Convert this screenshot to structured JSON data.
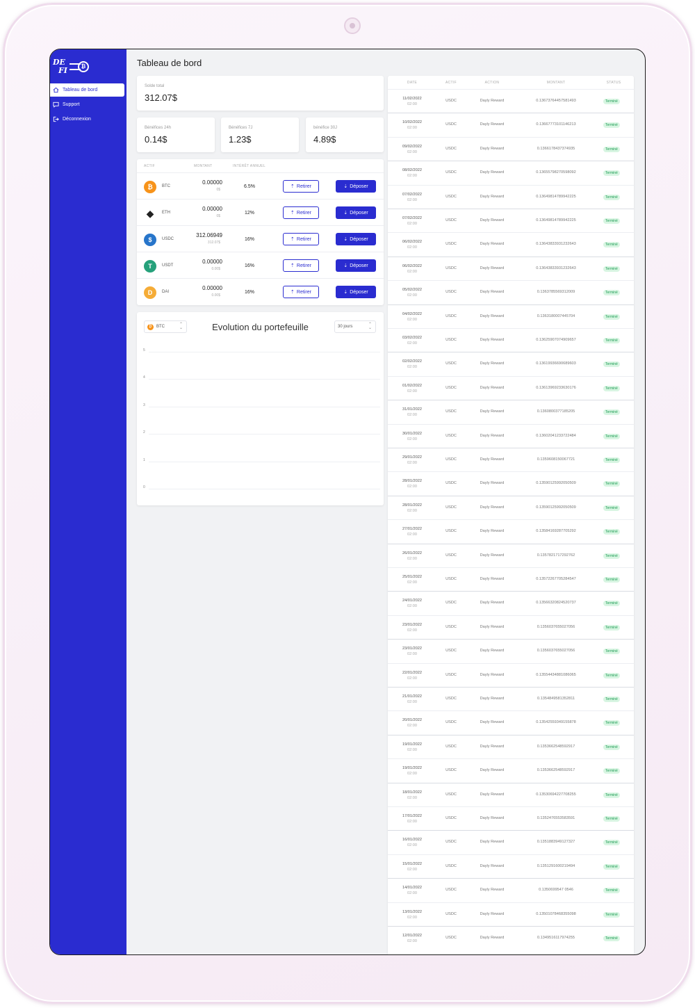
{
  "app": {
    "logo_line1": "DE",
    "logo_line2": "FI",
    "logo_coin": "₿"
  },
  "page": {
    "title": "Tableau de bord"
  },
  "nav": [
    {
      "label": "Tableau de bord",
      "icon": "home-icon",
      "active": true
    },
    {
      "label": "Support",
      "icon": "chat-icon",
      "active": false
    },
    {
      "label": "Déconnexion",
      "icon": "logout-icon",
      "active": false
    }
  ],
  "balance": {
    "label": "Solde total",
    "value": "312.07$"
  },
  "profits": [
    {
      "label": "Bénéfices 24h",
      "value": "0.14$"
    },
    {
      "label": "Bénéfices 7J",
      "value": "1.23$"
    },
    {
      "label": "bénéfice 30J",
      "value": "4.89$"
    }
  ],
  "assets_table": {
    "headers": {
      "asset": "ACTIF",
      "amount": "MONTANT",
      "interest": "INTÉRÊT ANNUEL"
    },
    "withdraw_label": "Retirer",
    "deposit_label": "Déposer",
    "rows": [
      {
        "name": "BTC",
        "amount": "0.00000",
        "sub": "0$",
        "interest": "6.5%",
        "icon": "bitcoin-icon",
        "color": "#f7931a",
        "glyph": "₿"
      },
      {
        "name": "ETH",
        "amount": "0.00000",
        "sub": "0$",
        "interest": "12%",
        "icon": "ethereum-icon",
        "color": "#222222",
        "glyph": "◆"
      },
      {
        "name": "USDC",
        "amount": "312.06949",
        "sub": "312.07$",
        "interest": "16%",
        "icon": "usdc-icon",
        "color": "#2775ca",
        "glyph": "$"
      },
      {
        "name": "USDT",
        "amount": "0.00000",
        "sub": "0.00$",
        "interest": "16%",
        "icon": "tether-icon",
        "color": "#26a17b",
        "glyph": "T"
      },
      {
        "name": "DAI",
        "amount": "0.00000",
        "sub": "0.00$",
        "interest": "16%",
        "icon": "dai-icon",
        "color": "#f5ac37",
        "glyph": "D"
      }
    ]
  },
  "portfolio_chart": {
    "title": "Evolution du portefeuille",
    "asset_select": "BTC",
    "period_select": "30 jours",
    "y_ticks": [
      "5",
      "4",
      "3",
      "2",
      "1",
      "0"
    ]
  },
  "chart_data": {
    "type": "line",
    "title": "Evolution du portefeuille",
    "series": [],
    "ylim": [
      0,
      5
    ],
    "grid": true
  },
  "transactions": {
    "headers": {
      "date": "DATE",
      "asset": "ACTIF",
      "action": "ACTION",
      "amount": "MONTANT",
      "status": "STATUS"
    },
    "rows": [
      {
        "date": "11/02/2022",
        "time": "02:00",
        "asset": "USDC",
        "action": "Dayly Reward",
        "amount": "0.13673764457581493",
        "status": "Terminé"
      },
      {
        "date": "10/02/2022",
        "time": "02:00",
        "asset": "USDC",
        "action": "Dayly Reward",
        "amount": "0.13667773101146213",
        "status": "Terminé"
      },
      {
        "date": "09/02/2022",
        "time": "02:00",
        "asset": "USDC",
        "action": "Dayly Reward",
        "amount": "0.1366178437374935",
        "status": "Terminé"
      },
      {
        "date": "08/02/2022",
        "time": "02:00",
        "asset": "USDC",
        "action": "Dayly Reward",
        "amount": "0.13655798270598092",
        "status": "Terminé"
      },
      {
        "date": "07/02/2022",
        "time": "02:00",
        "asset": "USDC",
        "action": "Dayly Reward",
        "amount": "0.13649814789942225",
        "status": "Terminé"
      },
      {
        "date": "07/02/2022",
        "time": "02:00",
        "asset": "USDC",
        "action": "Dayly Reward",
        "amount": "0.13649814789942225",
        "status": "Terminé"
      },
      {
        "date": "06/02/2022",
        "time": "02:00",
        "asset": "USDC",
        "action": "Dayly Reward",
        "amount": "0.13643833931232643",
        "status": "Terminé"
      },
      {
        "date": "06/02/2022",
        "time": "02:00",
        "asset": "USDC",
        "action": "Dayly Reward",
        "amount": "0.13643833931232643",
        "status": "Terminé"
      },
      {
        "date": "05/02/2022",
        "time": "02:00",
        "asset": "USDC",
        "action": "Dayly Reward",
        "amount": "0.1363785569312009",
        "status": "Terminé"
      },
      {
        "date": "04/02/2022",
        "time": "02:00",
        "asset": "USDC",
        "action": "Dayly Reward",
        "amount": "0.1363180007445704",
        "status": "Terminé"
      },
      {
        "date": "03/02/2022",
        "time": "02:00",
        "asset": "USDC",
        "action": "Dayly Reward",
        "amount": "0.13625907074909657",
        "status": "Terminé"
      },
      {
        "date": "02/02/2022",
        "time": "02:00",
        "asset": "USDC",
        "action": "Dayly Reward",
        "amount": "0.13619936690689603",
        "status": "Terminé"
      },
      {
        "date": "01/02/2022",
        "time": "02:00",
        "asset": "USDC",
        "action": "Dayly Reward",
        "amount": "0.13613969233630176",
        "status": "Terminé"
      },
      {
        "date": "31/01/2022",
        "time": "02:00",
        "asset": "USDC",
        "action": "Dayly Reward",
        "amount": "0.1360800377185205",
        "status": "Terminé"
      },
      {
        "date": "30/01/2022",
        "time": "02:00",
        "asset": "USDC",
        "action": "Dayly Reward",
        "amount": "0.13602041233722484",
        "status": "Terminé"
      },
      {
        "date": "29/01/2022",
        "time": "02:00",
        "asset": "USDC",
        "action": "Dayly Reward",
        "amount": "0.1359608150067721",
        "status": "Terminé"
      },
      {
        "date": "28/01/2022",
        "time": "02:00",
        "asset": "USDC",
        "action": "Dayly Reward",
        "amount": "0.13590125992050509",
        "status": "Terminé"
      },
      {
        "date": "28/01/2022",
        "time": "02:00",
        "asset": "USDC",
        "action": "Dayly Reward",
        "amount": "0.13590125992050509",
        "status": "Terminé"
      },
      {
        "date": "27/01/2022",
        "time": "02:00",
        "asset": "USDC",
        "action": "Dayly Reward",
        "amount": "0.13584169287705292",
        "status": "Terminé"
      },
      {
        "date": "26/01/2022",
        "time": "02:00",
        "asset": "USDC",
        "action": "Dayly Reward",
        "amount": "0.1357821717292762",
        "status": "Terminé"
      },
      {
        "date": "25/01/2022",
        "time": "02:00",
        "asset": "USDC",
        "action": "Dayly Reward",
        "amount": "0.13572267705284547",
        "status": "Terminé"
      },
      {
        "date": "24/01/2022",
        "time": "02:00",
        "asset": "USDC",
        "action": "Dayly Reward",
        "amount": "0.13566320824520737",
        "status": "Terminé"
      },
      {
        "date": "23/01/2022",
        "time": "02:00",
        "asset": "USDC",
        "action": "Dayly Reward",
        "amount": "0.1356037655027056",
        "status": "Terminé"
      },
      {
        "date": "23/01/2022",
        "time": "02:00",
        "asset": "USDC",
        "action": "Dayly Reward",
        "amount": "0.1356037655027056",
        "status": "Terminé"
      },
      {
        "date": "22/01/2022",
        "time": "02:00",
        "asset": "USDC",
        "action": "Dayly Reward",
        "amount": "0.13554434881086065",
        "status": "Terminé"
      },
      {
        "date": "21/01/2022",
        "time": "02:00",
        "asset": "USDC",
        "action": "Dayly Reward",
        "amount": "0.1354849581352811",
        "status": "Terminé"
      },
      {
        "date": "20/01/2022",
        "time": "02:00",
        "asset": "USDC",
        "action": "Dayly Reward",
        "amount": "0.13542559349155878",
        "status": "Terminé"
      },
      {
        "date": "19/01/2022",
        "time": "02:00",
        "asset": "USDC",
        "action": "Dayly Reward",
        "amount": "0.1353662548592917",
        "status": "Terminé"
      },
      {
        "date": "19/01/2022",
        "time": "02:00",
        "asset": "USDC",
        "action": "Dayly Reward",
        "amount": "0.1353662548592917",
        "status": "Terminé"
      },
      {
        "date": "18/01/2022",
        "time": "02:00",
        "asset": "USDC",
        "action": "Dayly Reward",
        "amount": "0.13530694227708255",
        "status": "Terminé"
      },
      {
        "date": "17/01/2022",
        "time": "02:00",
        "asset": "USDC",
        "action": "Dayly Reward",
        "amount": "0.1352476553583591",
        "status": "Terminé"
      },
      {
        "date": "16/01/2022",
        "time": "02:00",
        "asset": "USDC",
        "action": "Dayly Reward",
        "amount": "0.1351883949127327",
        "status": "Terminé"
      },
      {
        "date": "15/01/2022",
        "time": "02:00",
        "asset": "USDC",
        "action": "Dayly Reward",
        "amount": "0.1351291600219494",
        "status": "Terminé"
      },
      {
        "date": "14/01/2022",
        "time": "02:00",
        "asset": "USDC",
        "action": "Dayly Reward",
        "amount": "0.1350699547 0546",
        "status": "Terminé"
      },
      {
        "date": "13/01/2022",
        "time": "02:00",
        "asset": "USDC",
        "action": "Dayly Reward",
        "amount": "0.13501078468355098",
        "status": "Terminé"
      },
      {
        "date": "12/01/2022",
        "time": "02:00",
        "asset": "USDC",
        "action": "Dayly Reward",
        "amount": "0.1349516117974255",
        "status": "Terminé"
      }
    ]
  },
  "colors": {
    "primary": "#2a2cd0",
    "success": "#1f9d55",
    "success_bg": "#d8f5e2",
    "background": "#f1f2f4"
  }
}
